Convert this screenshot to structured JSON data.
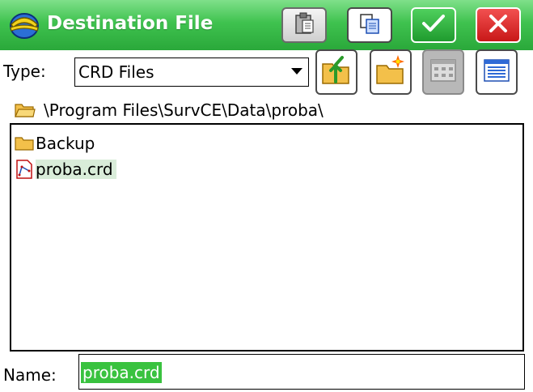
{
  "window": {
    "title": "Destination File",
    "icon": "surveyor-helmet-icon",
    "accent_color": "#3fc24f"
  },
  "title_buttons": [
    {
      "name": "paste-button",
      "icon": "clipboard-paste-icon"
    },
    {
      "name": "copy-button",
      "icon": "copy-icon"
    },
    {
      "name": "ok-button",
      "icon": "checkmark-icon",
      "color": "#2fa83c"
    },
    {
      "name": "cancel-button",
      "icon": "close-icon",
      "color": "#d42020"
    }
  ],
  "toolbar": {
    "type_label": "Type:",
    "type_value": "CRD Files",
    "buttons": [
      {
        "name": "folder-up-button",
        "icon": "folder-up-icon"
      },
      {
        "name": "new-folder-button",
        "icon": "new-folder-icon"
      },
      {
        "name": "icon-view-button",
        "icon": "icon-view-icon",
        "disabled": true
      },
      {
        "name": "list-view-button",
        "icon": "list-view-icon"
      }
    ]
  },
  "path": {
    "icon": "folder-open-icon",
    "text": "\\Program Files\\SurvCE\\Data\\proba\\"
  },
  "files": [
    {
      "label": "Backup",
      "icon": "folder-icon",
      "selected": false
    },
    {
      "label": "proba.crd",
      "icon": "crd-file-icon",
      "selected": true
    }
  ],
  "name_field": {
    "label": "Name:",
    "value": "proba.crd"
  }
}
